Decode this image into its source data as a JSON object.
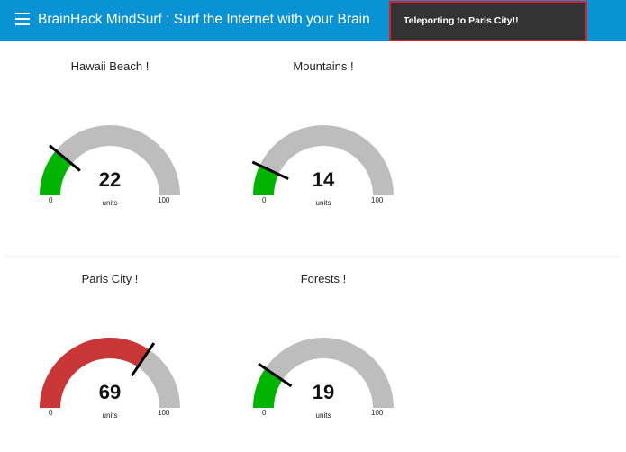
{
  "header": {
    "title": "BrainHack MindSurf : Surf the Internet with your Brain",
    "bg_color": "#0a93d4"
  },
  "toast": {
    "message": "Teleporting to Paris City!!"
  },
  "gauges": [
    {
      "title": "Hawaii Beach !",
      "value": 22,
      "value_text": "22",
      "units": "units",
      "min": "0",
      "max": "100",
      "fill_color": "#00b400"
    },
    {
      "title": "Mountains !",
      "value": 14,
      "value_text": "14",
      "units": "units",
      "min": "0",
      "max": "100",
      "fill_color": "#00b400"
    },
    {
      "title": "Paris City !",
      "value": 69,
      "value_text": "69",
      "units": "units",
      "min": "0",
      "max": "100",
      "fill_color": "#c93636"
    },
    {
      "title": "Forests !",
      "value": 19,
      "value_text": "19",
      "units": "units",
      "min": "0",
      "max": "100",
      "fill_color": "#00b400"
    }
  ],
  "track_color": "#bdbdbd",
  "needle_color": "#000000"
}
